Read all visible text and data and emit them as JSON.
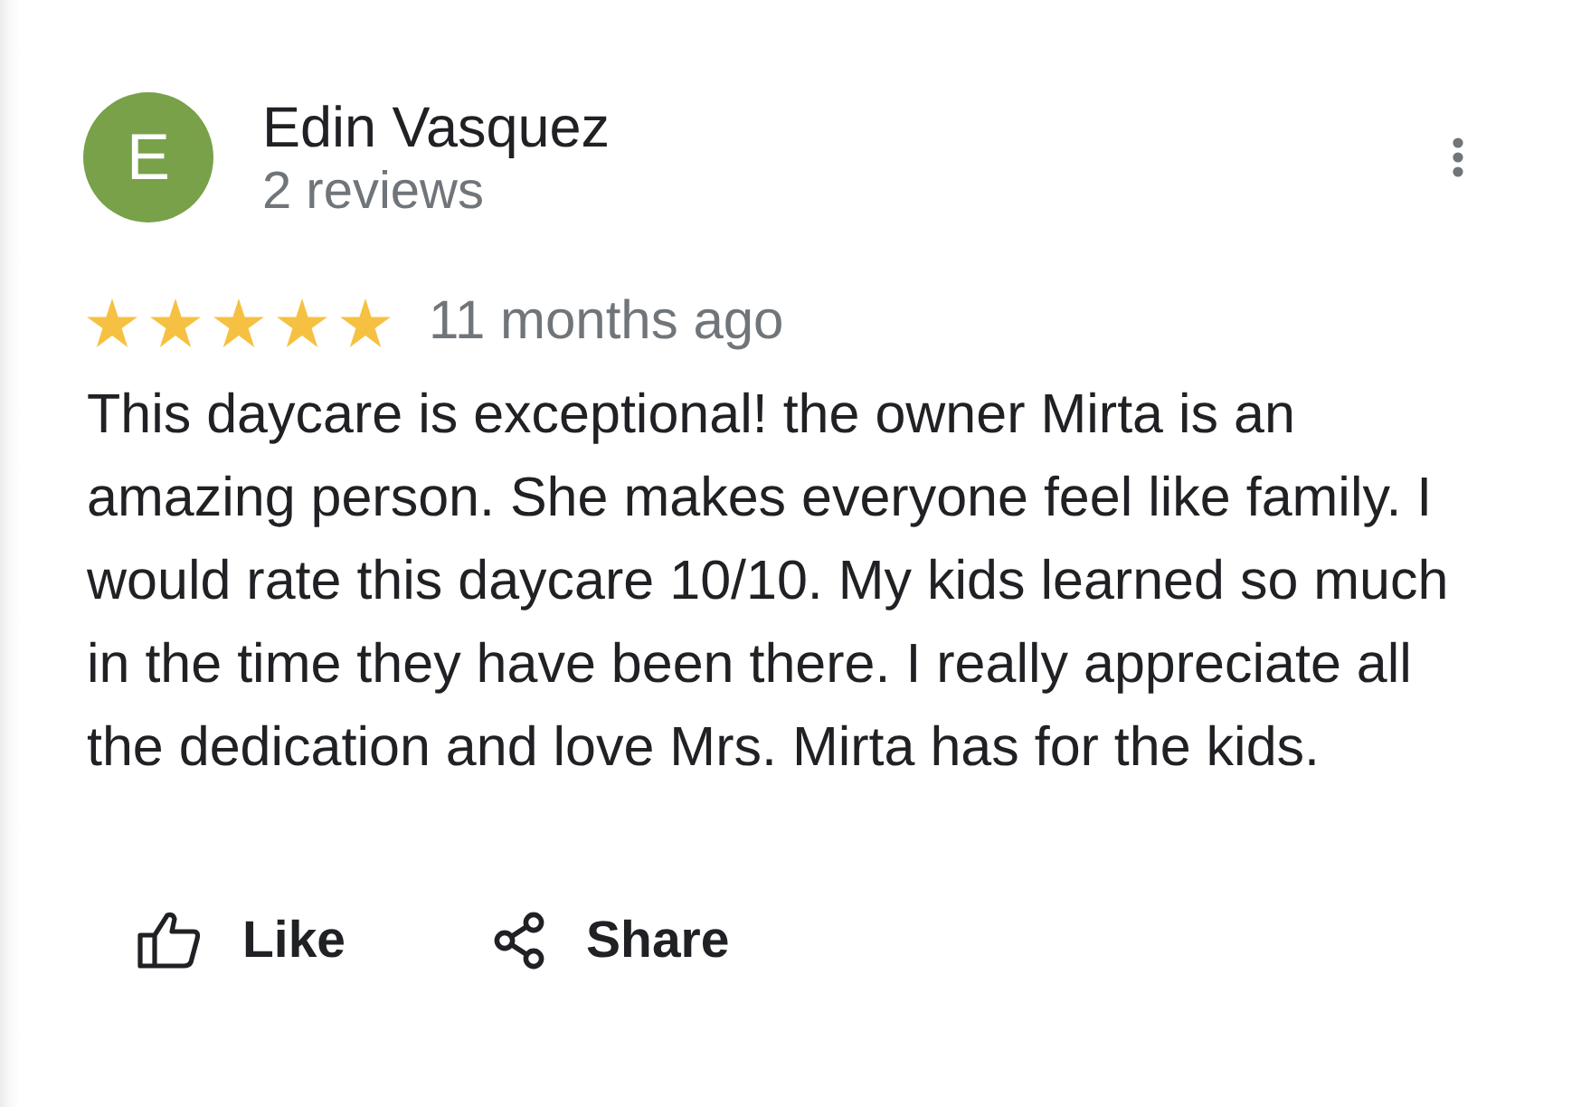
{
  "reviewer": {
    "avatar_letter": "E",
    "name": "Edin Vasquez",
    "review_count": "2 reviews"
  },
  "rating": {
    "stars": 5,
    "time": "11 months ago"
  },
  "review_text": "This daycare is exceptional! the owner Mirta is an amazing person. She makes everyone feel like family. I would rate this daycare 10/10. My kids learned so much in the time they have been there. I really appreciate all the dedication and love Mrs. Mirta has for the kids.",
  "actions": [
    {
      "kind": "like",
      "label": "Like"
    },
    {
      "kind": "share",
      "label": "Share"
    }
  ]
}
